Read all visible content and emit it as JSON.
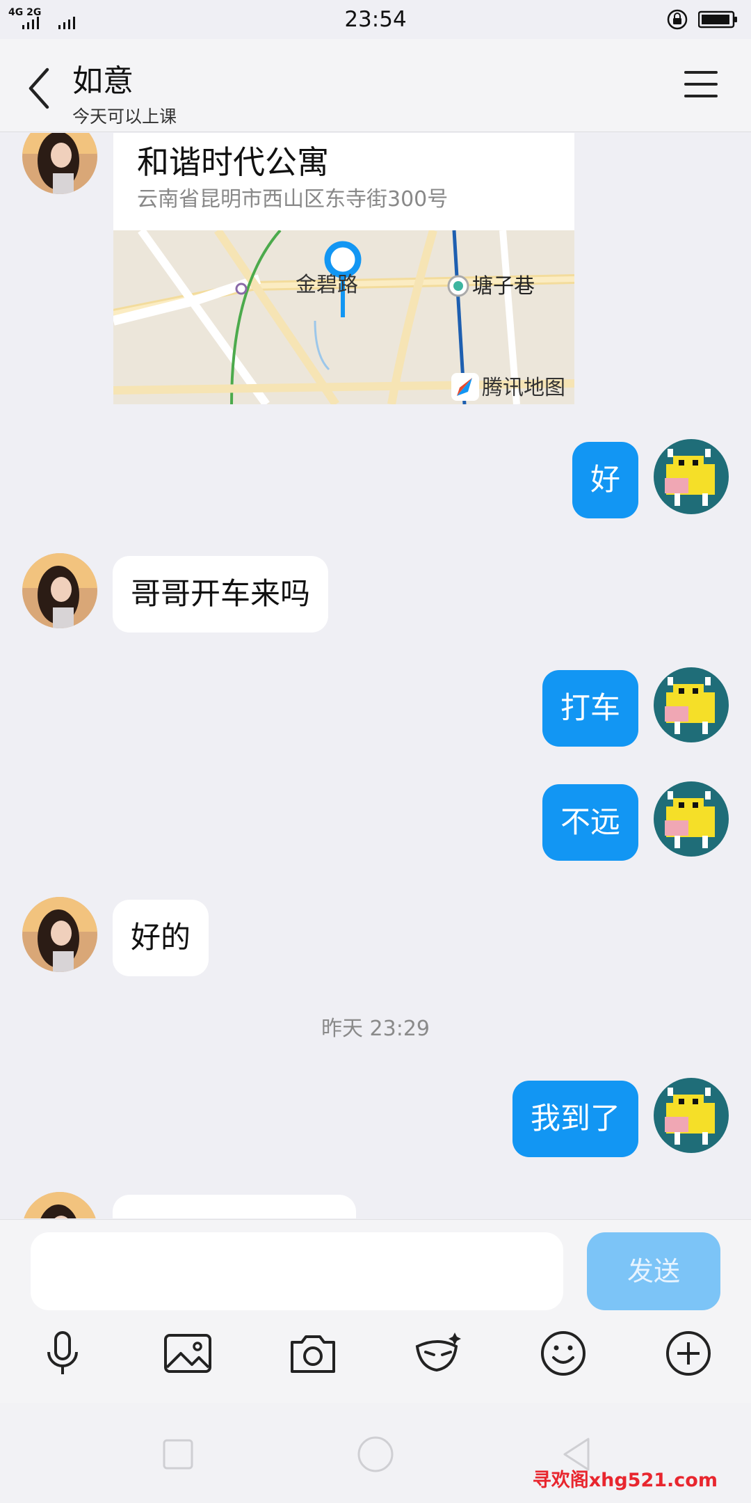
{
  "status_bar": {
    "signal_label": "4G  2G",
    "time": "23:54"
  },
  "header": {
    "title": "如意",
    "subtitle": "今天可以上课"
  },
  "location_card": {
    "place_name": "和谐时代公寓",
    "address": "云南省昆明市西山区东寺街300号",
    "map_labels": [
      "金碧路",
      "塘子巷",
      "腾讯地图"
    ]
  },
  "messages": [
    {
      "side": "out",
      "text": "好"
    },
    {
      "side": "in",
      "text": "哥哥开车来吗"
    },
    {
      "side": "out",
      "text": "打车"
    },
    {
      "side": "out",
      "text": "不远"
    },
    {
      "side": "in",
      "text": "好的"
    },
    {
      "side": "out",
      "text": "我到了"
    }
  ],
  "timestamp": "昨天 23:29",
  "input": {
    "placeholder": "",
    "send_label": "发送"
  },
  "toolbar": [
    "microphone-icon",
    "image-icon",
    "camera-icon",
    "red-packet-mask-icon",
    "emoji-icon",
    "plus-icon"
  ],
  "watermark": "寻欢阁xhg521.com",
  "colors": {
    "outgoing_bubble": "#1296f3",
    "incoming_bubble": "#ffffff",
    "send_button": "#7cc4f7",
    "background": "#efeff4"
  }
}
